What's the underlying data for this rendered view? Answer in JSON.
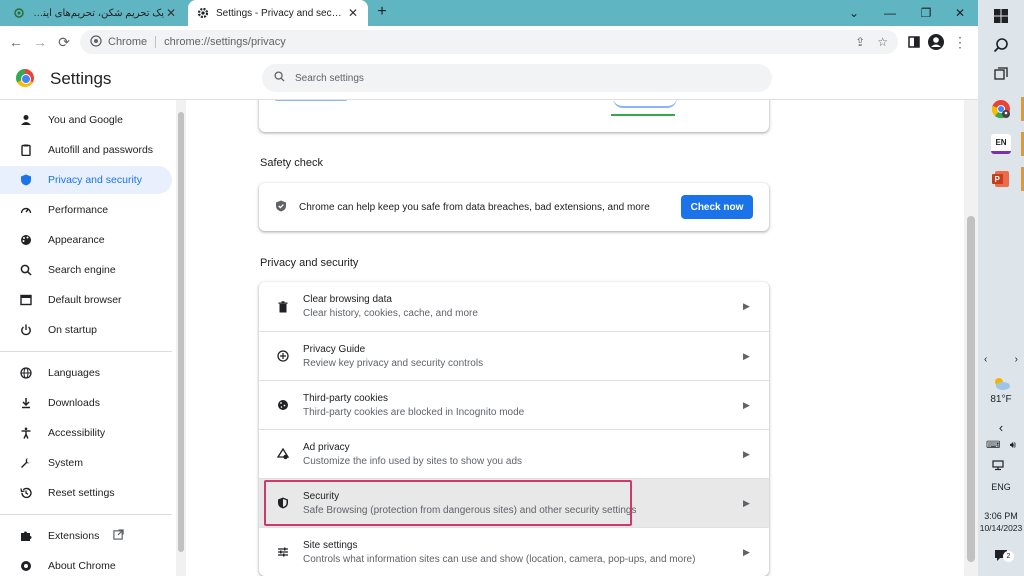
{
  "tabs": [
    {
      "title": "یک تحریم شکن، تحریم‌های اینترنتی",
      "active": false
    },
    {
      "title": "Settings - Privacy and security",
      "active": true
    }
  ],
  "window_controls": [
    "minimize",
    "restore",
    "close"
  ],
  "toolbar": {
    "site_label": "Chrome",
    "url": "chrome://settings/privacy"
  },
  "settings": {
    "title": "Settings",
    "search_placeholder": "Search settings"
  },
  "sidebar": {
    "items": [
      {
        "label": "You and Google",
        "icon": "person-icon"
      },
      {
        "label": "Autofill and passwords",
        "icon": "clipboard-icon"
      },
      {
        "label": "Privacy and security",
        "icon": "shield-icon",
        "selected": true
      },
      {
        "label": "Performance",
        "icon": "speedometer-icon"
      },
      {
        "label": "Appearance",
        "icon": "palette-icon"
      },
      {
        "label": "Search engine",
        "icon": "search-icon"
      },
      {
        "label": "Default browser",
        "icon": "browser-icon"
      },
      {
        "label": "On startup",
        "icon": "power-icon"
      }
    ],
    "items2": [
      {
        "label": "Languages",
        "icon": "globe-icon"
      },
      {
        "label": "Downloads",
        "icon": "download-icon"
      },
      {
        "label": "Accessibility",
        "icon": "accessibility-icon"
      },
      {
        "label": "System",
        "icon": "wrench-icon"
      },
      {
        "label": "Reset settings",
        "icon": "history-icon"
      }
    ],
    "items3": [
      {
        "label": "Extensions",
        "icon": "puzzle-icon"
      },
      {
        "label": "About Chrome",
        "icon": "chrome-icon"
      }
    ]
  },
  "safety_check": {
    "heading": "Safety check",
    "text": "Chrome can help keep you safe from data breaches, bad extensions, and more",
    "button": "Check now"
  },
  "privacy": {
    "heading": "Privacy and security",
    "rows": [
      {
        "title": "Clear browsing data",
        "sub": "Clear history, cookies, cache, and more",
        "icon": "trash-icon"
      },
      {
        "title": "Privacy Guide",
        "sub": "Review key privacy and security controls",
        "icon": "compass-icon"
      },
      {
        "title": "Third-party cookies",
        "sub": "Third-party cookies are blocked in Incognito mode",
        "icon": "cookie-icon"
      },
      {
        "title": "Ad privacy",
        "sub": "Customize the info used by sites to show you ads",
        "icon": "ad-privacy-icon"
      },
      {
        "title": "Security",
        "sub": "Safe Browsing (protection from dangerous sites) and other security settings",
        "icon": "shield-icon",
        "highlighted": true
      },
      {
        "title": "Site settings",
        "sub": "Controls what information sites can use and show (location, camera, pop-ups, and more)",
        "icon": "sliders-icon"
      }
    ]
  },
  "taskbar": {
    "lang_chip": "EN",
    "temperature": "81°F",
    "language": "ENG",
    "time": "3:06 PM",
    "date": "10/14/2023",
    "notifications": "2"
  },
  "colors": {
    "tab_strip": "#5fb6c2",
    "accent": "#1a73e8",
    "highlight_border": "#d03869",
    "taskbar": "#dde5ea"
  }
}
